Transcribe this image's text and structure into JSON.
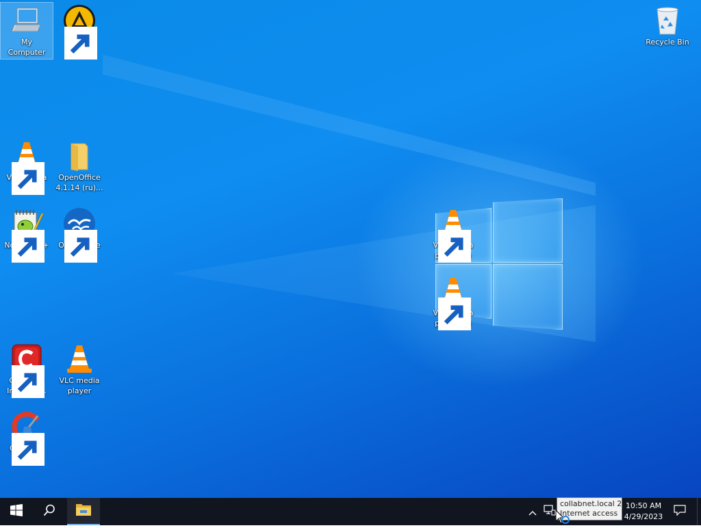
{
  "desktop": {
    "icons": {
      "my_computer": {
        "label": "My Computer",
        "icon": "computer-icon",
        "selected": true
      },
      "aimp": {
        "label": "AIMP",
        "icon": "aimp-icon"
      },
      "recycle_bin": {
        "label": "Recycle Bin",
        "icon": "recycle-bin-icon"
      },
      "vlc_1": {
        "label": "VLC media player",
        "icon": "vlc-cone-icon"
      },
      "openoffice_folder": {
        "label": "OpenOffice 4.1.14 (ru)...",
        "icon": "folder-icon"
      },
      "notepadpp": {
        "label": "Notepad++",
        "icon": "notepadpp-icon"
      },
      "openoffice": {
        "label": "OpenOffice 4.1.14",
        "icon": "openoffice-gulls-icon"
      },
      "vlc_4": {
        "label": "VLC media player (4)",
        "icon": "vlc-cone-icon"
      },
      "vlc_5": {
        "label": "VLC media player (5)",
        "icon": "vlc-cone-icon"
      },
      "comodo": {
        "label": "COMODO Internet ...",
        "icon": "comodo-icon"
      },
      "vlc_2": {
        "label": "VLC media player",
        "icon": "vlc-cone-icon"
      },
      "ccleaner": {
        "label": "CCleaner",
        "icon": "ccleaner-icon"
      }
    }
  },
  "taskbar": {
    "start": {
      "icon": "windows-start-icon"
    },
    "search": {
      "icon": "search-icon"
    },
    "file_explorer": {
      "icon": "file-explorer-icon",
      "active": true
    },
    "tray": {
      "chevron": {
        "icon": "chevron-up-icon"
      },
      "network": {
        "icon": "network-icon"
      },
      "tooltip": {
        "line1": "collabnet.local 2",
        "line2": "Internet access"
      },
      "clock": {
        "time": "10:50 AM",
        "date": "4/29/2023"
      },
      "notifications": {
        "icon": "action-center-icon"
      }
    }
  },
  "colors": {
    "wallpaper": "#0a7fe6",
    "taskbar": "#101520",
    "accent": "#7db5ea"
  }
}
